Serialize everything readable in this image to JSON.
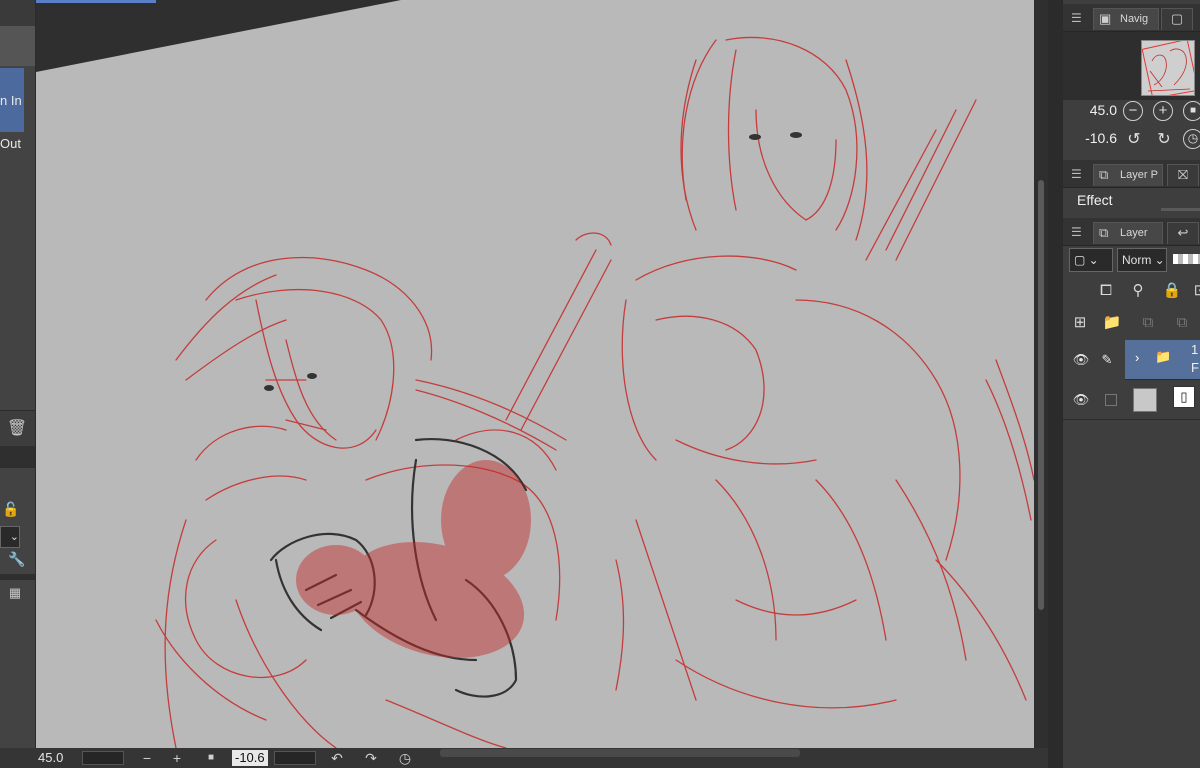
{
  "left_panel": {
    "zoom_in_label": "n In",
    "zoom_out_label": "Out",
    "trash_icon": "trash-icon",
    "lock_icon": "lock-icon",
    "wrench_icon": "wrench-icon",
    "film_icon": "film-icon"
  },
  "statusbar": {
    "zoom_value": "45.0",
    "minus": "−",
    "plus": "+",
    "stop": "■",
    "rotation_value": "-10.6"
  },
  "navigator": {
    "tab_label": "Navig",
    "zoom_value": "45.0",
    "rotation_value": "-10.6"
  },
  "layer_property": {
    "tab_label": "Layer P",
    "effect_label": "Effect"
  },
  "layer_panel": {
    "tab_label": "Layer",
    "blend_mode": "Norm",
    "layers": [
      {
        "name": "1",
        "sub": "F",
        "type": "folder"
      },
      {
        "name": "",
        "sub": "",
        "type": "paper"
      }
    ]
  },
  "colors": {
    "canvas": "#b9b9b9",
    "sketch_red": "#c62828",
    "sketch_dark": "#333333",
    "active_layer": "#56709c",
    "accent": "#5b7fc7"
  }
}
